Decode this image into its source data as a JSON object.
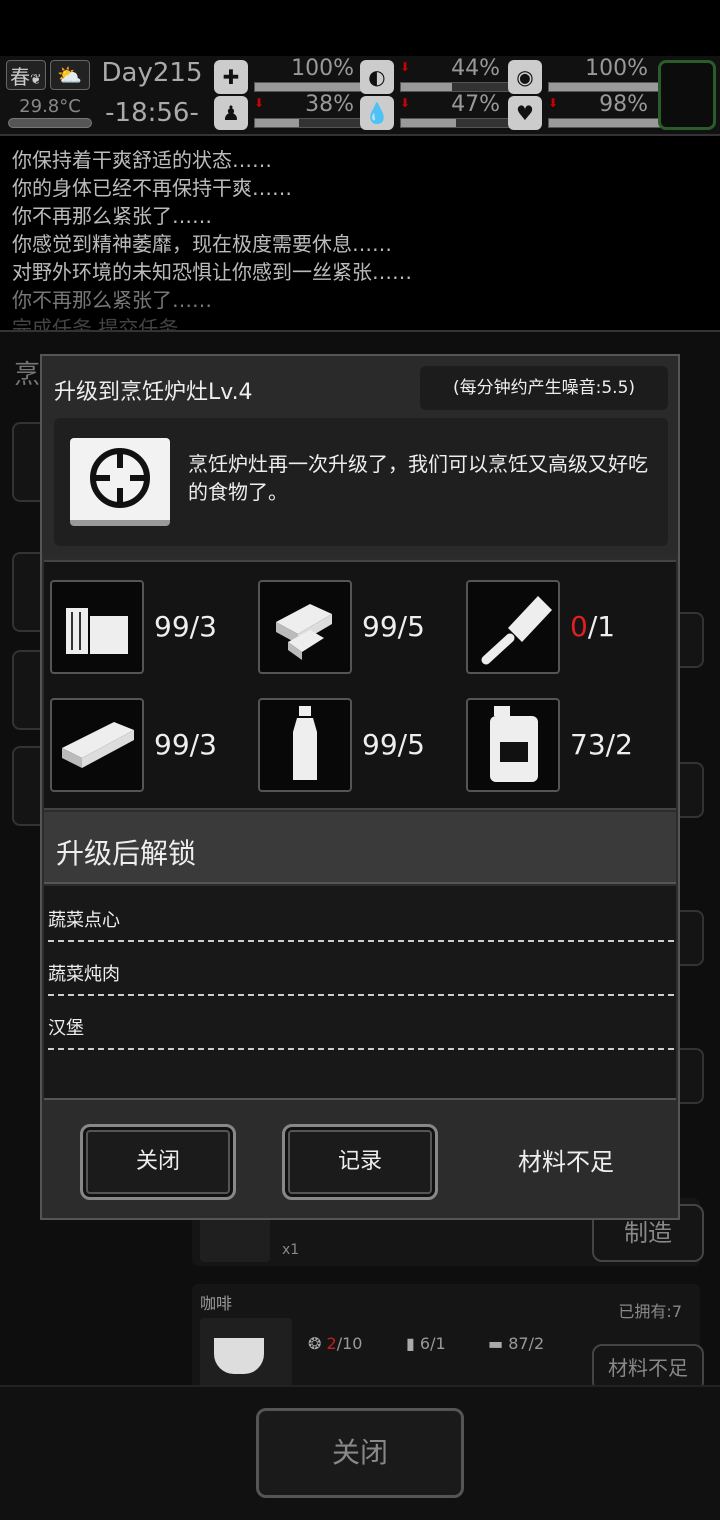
{
  "hud": {
    "season": "春",
    "temperature": "29.8°C",
    "day": "Day215",
    "time": "-18:56-",
    "stats": [
      {
        "name": "health",
        "icon": "medkit-icon",
        "percent": "100%",
        "value": 100,
        "decreasing": false
      },
      {
        "name": "hunger",
        "icon": "stomach-icon",
        "percent": "44%",
        "value": 44,
        "decreasing": true
      },
      {
        "name": "mood",
        "icon": "brain-icon",
        "percent": "100%",
        "value": 100,
        "decreasing": false
      },
      {
        "name": "stamina",
        "icon": "boot-icon",
        "percent": "38%",
        "value": 38,
        "decreasing": true
      },
      {
        "name": "thirst",
        "icon": "water-drop-icon",
        "percent": "47%",
        "value": 47,
        "decreasing": true
      },
      {
        "name": "spirit",
        "icon": "heart-icon",
        "percent": "98%",
        "value": 98,
        "decreasing": true
      }
    ]
  },
  "log": [
    "你保持着干爽舒适的状态……",
    "你的身体已经不再保持干爽……",
    "你不再那么紧张了……",
    "你感觉到精神萎靡，现在极度需要休息……",
    "对野外环境的未知恐惧让你感到一丝紧张……",
    "你不再那么紧张了……",
    "完成任务 提交任务"
  ],
  "background": {
    "panel_title": "烹",
    "recipe_partial": {
      "owned": "x1",
      "make_label": "制造"
    },
    "recipe_coffee": {
      "name": "咖啡",
      "owned": "已拥有:7",
      "reqs": [
        {
          "have": "2",
          "need": "/10",
          "lack": true
        },
        {
          "have": "6",
          "need": "/1",
          "lack": false
        },
        {
          "have": "87",
          "need": "/2",
          "lack": false
        }
      ],
      "make_label": "材料不足"
    },
    "close_label": "关闭"
  },
  "modal": {
    "title": "升级到烹饪炉灶Lv.4",
    "noise": "(每分钟约产生噪音:5.5)",
    "description": "烹饪炉灶再一次升级了，我们可以烹饪又高级又好吃的食物了。",
    "materials": [
      {
        "icon": "wood-log-icon",
        "have": "99",
        "need": "/3",
        "lack": false
      },
      {
        "icon": "wood-planks-icon",
        "have": "99",
        "need": "/5",
        "lack": false
      },
      {
        "icon": "cleaver-icon",
        "have": "0",
        "need": "/1",
        "lack": true
      },
      {
        "icon": "metal-plate-icon",
        "have": "99",
        "need": "/3",
        "lack": false
      },
      {
        "icon": "bottle-icon",
        "have": "99",
        "need": "/5",
        "lack": false
      },
      {
        "icon": "oil-jug-icon",
        "have": "73",
        "need": "/2",
        "lack": false
      }
    ],
    "unlock_header": "升级后解锁",
    "unlocks": [
      "蔬菜点心",
      "蔬菜炖肉",
      "汉堡"
    ],
    "buttons": {
      "close": "关闭",
      "record": "记录"
    },
    "status": "材料不足"
  }
}
